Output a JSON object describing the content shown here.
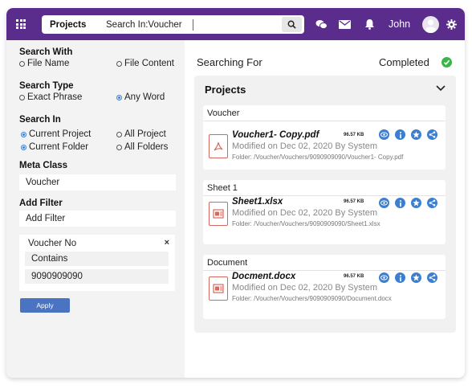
{
  "header": {
    "search_scope": "Projects",
    "search_text": "Search In:Voucher",
    "username": "John"
  },
  "sidebar": {
    "search_with": {
      "label": "Search With",
      "options": [
        {
          "label": "File Name",
          "selected": false
        },
        {
          "label": "File Content",
          "selected": false
        }
      ]
    },
    "search_type": {
      "label": "Search Type",
      "options": [
        {
          "label": "Exact Phrase",
          "selected": false
        },
        {
          "label": "Any Word",
          "selected": true
        }
      ]
    },
    "search_in": {
      "label": "Search In",
      "options": [
        {
          "label": "Current Project",
          "selected": true
        },
        {
          "label": "All Project",
          "selected": false
        },
        {
          "label": "Current Folder",
          "selected": true
        },
        {
          "label": "All Folders",
          "selected": false
        }
      ]
    },
    "meta_class": {
      "label": "Meta Class",
      "value": "Voucher"
    },
    "add_filter": {
      "label": "Add Filter",
      "value": "Add Filter"
    },
    "filter": {
      "title": "Voucher No",
      "close": "×",
      "condition": "Contains",
      "value": "9090909090"
    },
    "apply_label": "Apply"
  },
  "main": {
    "searching_label": "Searching For",
    "status": "Completed",
    "results_title": "Projects",
    "groups": [
      {
        "header": "Voucher",
        "file": {
          "name": "Voucher1- Copy.pdf",
          "size": "96.57 KB",
          "modified": "Modified on Dec 02, 2020 By System",
          "folder": "Folder: /Voucher/Vouchers/9090909090/Voucher1- Copy.pdf",
          "type_icon": "pdf-icon"
        }
      },
      {
        "header": "Sheet 1",
        "file": {
          "name": "Sheet1.xlsx",
          "size": "96.57 KB",
          "modified": "Modified on Dec 02, 2020 By System",
          "folder": "Folder: /Voucher/Vouchers/9090909090/Sheet1.xlsx",
          "type_icon": "office-icon"
        }
      },
      {
        "header": "Document",
        "file": {
          "name": "Docment.docx",
          "size": "96.57 KB",
          "modified": "Modified on Dec 02, 2020 By System",
          "folder": "Folder: /Voucher/Vouchers/9090909090/Document.docx",
          "type_icon": "office-icon"
        }
      }
    ]
  },
  "colors": {
    "topbar": "#5a2d8c",
    "accent": "#3c7fd0",
    "apply": "#4a74c1",
    "success": "#3ab54a",
    "file_icon": "#d46a5f"
  }
}
